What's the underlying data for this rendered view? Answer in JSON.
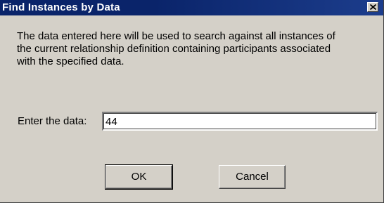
{
  "window": {
    "title": "Find Instances by Data",
    "close_icon": "close-icon"
  },
  "description": {
    "lines": [
      "The data entered here will be used to search against all instances of",
      "the current relationship definition containing participants associated",
      "with the specified data."
    ]
  },
  "form": {
    "label": "Enter the data:",
    "value": "44"
  },
  "buttons": {
    "ok_label": "OK",
    "cancel_label": "Cancel"
  },
  "colors": {
    "titlebar": "#0a246a",
    "dialog_bg": "#d4d0c8"
  }
}
